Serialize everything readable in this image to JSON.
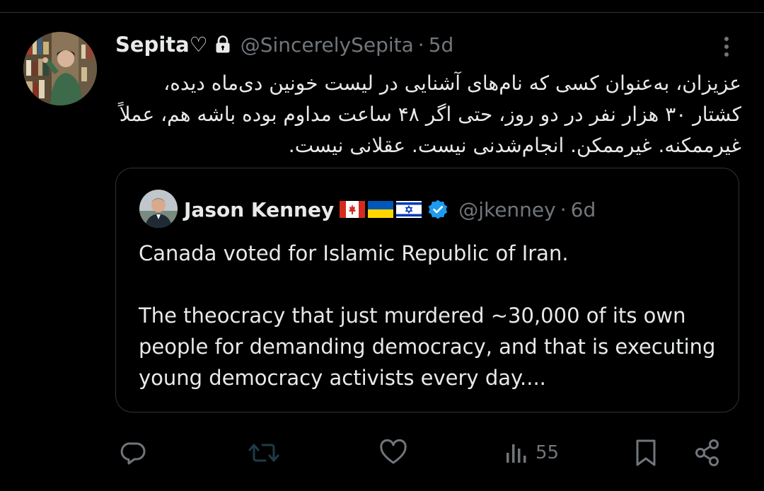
{
  "tweet": {
    "author": {
      "display_name": "Sepita♡",
      "handle": "@SincerelySepita",
      "protected": true
    },
    "separator": "·",
    "time": "5d",
    "text": "عزیزان، به‌عنوان کسی که نام‌های آشنایی در لیست خونین دی‌ماه دیده، کشتار ۳۰ هزار نفر در دو روز، حتی اگر ۴۸ ساعت مداوم بوده باشه هم، عملاً غیرممکنه. غیرممکن. انجام‌شدنی نیست. عقلانی نیست."
  },
  "quoted_tweet": {
    "author": {
      "display_name": "Jason Kenney",
      "flags": [
        "canada-flag",
        "ukraine-flag",
        "israel-flag"
      ],
      "verified": true,
      "handle": "@jkenney"
    },
    "separator": "·",
    "time": "6d",
    "paragraph_1": "Canada voted for Islamic Republic of Iran.",
    "paragraph_2": "The theocracy that just murdered ~30,000 of its own people for demanding democracy, and that is executing young democracy activists every day...."
  },
  "actions": {
    "reply_icon": "reply-icon",
    "retweet_icon": "retweet-icon",
    "like_icon": "heart-icon",
    "views_icon": "views-icon",
    "views_count": "55",
    "bookmark_icon": "bookmark-icon",
    "share_icon": "share-icon"
  },
  "colors": {
    "background": "#000000",
    "text": "#e7e9ea",
    "secondary": "#71767b",
    "border": "#2f3336",
    "verified": "#1d9bf0"
  }
}
